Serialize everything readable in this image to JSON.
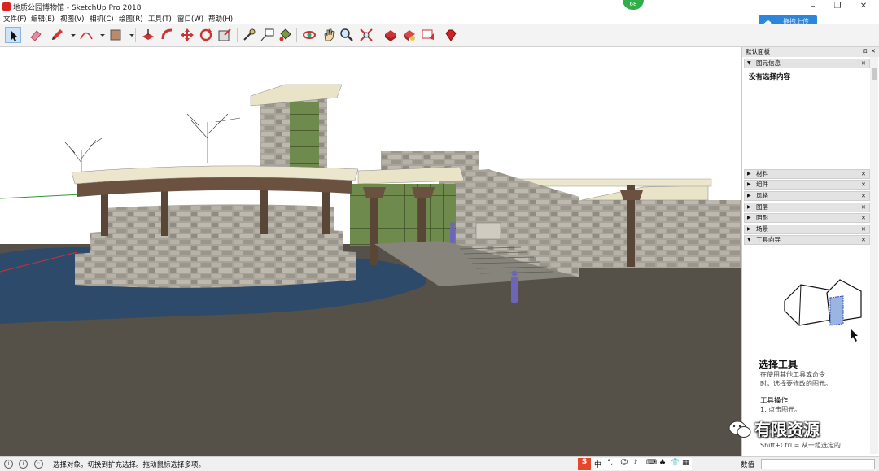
{
  "window": {
    "title": "地质公园博物馆 - SketchUp Pro 2018",
    "badge": "68",
    "controls": {
      "minimize": "–",
      "maximize": "❐",
      "close": "✕"
    }
  },
  "menu": [
    "文件(F)",
    "编辑(E)",
    "视图(V)",
    "相机(C)",
    "绘图(R)",
    "工具(T)",
    "窗口(W)",
    "帮助(H)"
  ],
  "cloud_upload": {
    "label": "拖拽上传",
    "icon": "cloud-icon"
  },
  "toolbar": {
    "tools": [
      "select-icon",
      "eraser-icon",
      "pencil-icon",
      "arc-icon",
      "shape-icon",
      "push-pull-icon",
      "follow-me-icon",
      "move-icon",
      "rotate-icon",
      "scale-icon",
      "tape-measure-icon",
      "text-icon",
      "paint-bucket-icon",
      "orbit-icon",
      "pan-icon",
      "zoom-icon",
      "zoom-extents-icon",
      "warehouse-icon",
      "extension-icon",
      "layout-icon",
      "ruby-icon"
    ],
    "active_tool": "select-icon"
  },
  "tray": {
    "title": "默认面板",
    "entity_info": {
      "label": "图元信息",
      "content": "没有选择内容"
    },
    "panels": [
      "材料",
      "组件",
      "风格",
      "图层",
      "阴影",
      "场景",
      "工具向导"
    ],
    "instructor": {
      "title": "选择工具",
      "desc_1": "在使用其他工具或命令",
      "desc_2": "时，选择要修改的图元。",
      "ops_head": "工具操作",
      "op_1": "1. 点击图元。",
      "func_head": "功能键",
      "func_1": "Ctrl = 添加到选择",
      "func_2": "Shift+Ctrl = 从一组选定的"
    }
  },
  "status": {
    "text": "选择对象。切换到扩充选择。拖动鼠标选择多项。",
    "measure_label": "数值",
    "ime": [
      "中",
      "°,",
      "☺",
      "♪",
      "⌨",
      "♣",
      "👕",
      "▦"
    ]
  },
  "watermark": {
    "text": "有限资源",
    "icon": "wechat-icon"
  },
  "colors": {
    "sky": "#ffffff",
    "ground": "#555148",
    "water": "#2e4a6b",
    "accent": "#2d86d9",
    "stone": "#9c9890"
  }
}
